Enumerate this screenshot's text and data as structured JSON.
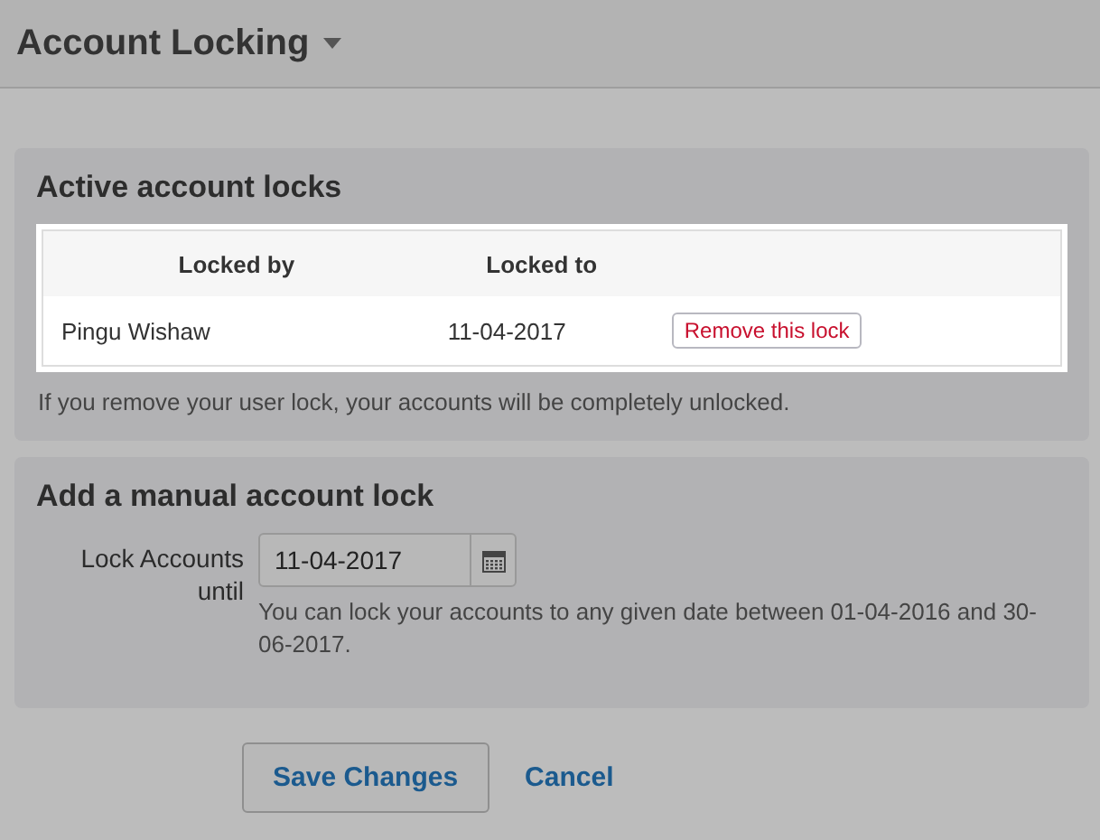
{
  "header": {
    "title": "Account Locking"
  },
  "active_locks": {
    "title": "Active account locks",
    "columns": [
      "Locked by",
      "Locked to"
    ],
    "rows": [
      {
        "locked_by": "Pingu Wishaw",
        "locked_to": "11-04-2017",
        "action": "Remove this lock"
      }
    ],
    "note": "If you remove your user lock, your accounts will be completely unlocked."
  },
  "manual_lock": {
    "title": "Add a manual account lock",
    "label": "Lock Accounts until",
    "value": "11-04-2017",
    "help": "You can lock your accounts to any given date between 01-04-2016 and 30-06-2017."
  },
  "buttons": {
    "save": "Save Changes",
    "cancel": "Cancel"
  }
}
